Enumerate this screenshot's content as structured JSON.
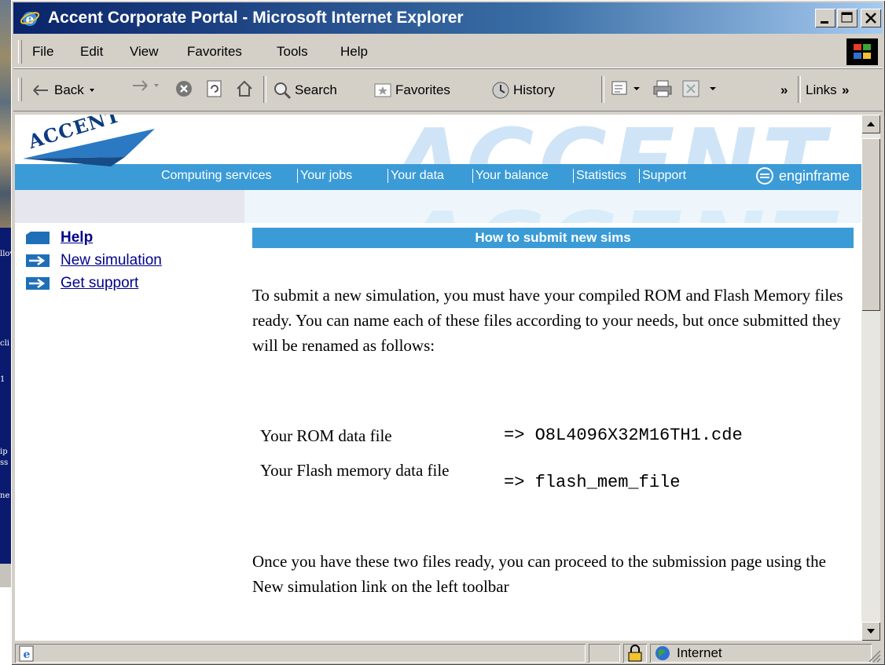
{
  "window": {
    "title": "Accent Corporate Portal - Microsoft Internet Explorer"
  },
  "menubar": {
    "items": [
      "File",
      "Edit",
      "View",
      "Favorites",
      "Tools",
      "Help"
    ]
  },
  "toolbar": {
    "back_label": "Back",
    "search_label": "Search",
    "favorites_label": "Favorites",
    "history_label": "History",
    "overflow_label": "»",
    "links_label": "Links"
  },
  "page": {
    "logo_text": "ACCENT",
    "watermark_text": "ACCENT",
    "nav": [
      "Computing services",
      "Your jobs",
      "Your data",
      "Your balance",
      "Statistics",
      "Support"
    ],
    "enginframe_label": "enginframe",
    "sidebar": [
      {
        "label": "Help",
        "current": true
      },
      {
        "label": "New simulation",
        "current": false
      },
      {
        "label": "Get support",
        "current": false
      }
    ],
    "section_title": "How to submit new sims",
    "intro": "To submit a new simulation, you must have your compiled ROM and Flash Memory files ready. You can name each of these files according to your needs, but once submitted they will be renamed as follows:",
    "files": [
      {
        "label": "Your ROM data file",
        "value": "=> O8L4096X32M16TH1.cde"
      },
      {
        "label": "Your Flash memory data file",
        "value": "=> flash_mem_file"
      }
    ],
    "outro": "Once you have these two files ready, you can proceed to the submission page using the New simulation link on the left toolbar"
  },
  "statusbar": {
    "zone": "Internet"
  },
  "background_window": {
    "fragments": [
      "llov",
      "cli",
      "1",
      "ip",
      "ss",
      "ne"
    ]
  },
  "colors": {
    "titlebar": "#0a246a",
    "accent_blue": "#3b9bd7",
    "link": "#00008b"
  }
}
